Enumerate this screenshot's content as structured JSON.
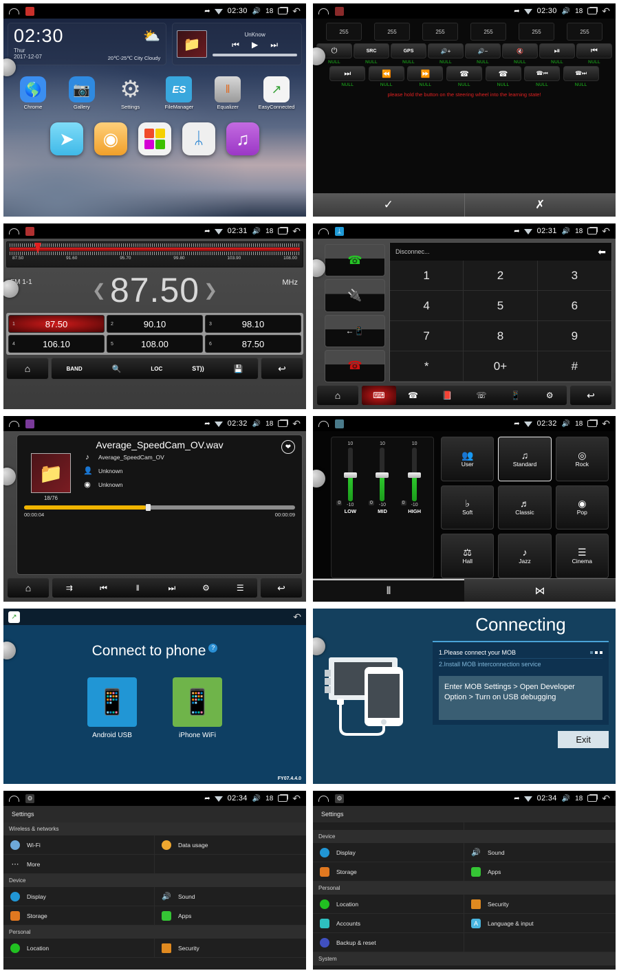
{
  "statusbar": {
    "time_0230": "02:30",
    "time_0231": "02:31",
    "time_0232": "02:32",
    "time_0234": "02:34",
    "volume": "18",
    "key_icon": "key-icon",
    "wifi_icon": "wifi-icon",
    "speaker_icon": "speaker-icon",
    "recents_icon": "recents-icon",
    "back_icon": "back-icon",
    "home_icon": "home-icon"
  },
  "home": {
    "clock": {
      "time": "02:30",
      "day": "Thur",
      "date": "2017-12-07",
      "weather_icon": "sun-cloud-icon",
      "temperature": "20℃-25℃ City Cloudy"
    },
    "media": {
      "title": "UnKnow",
      "prev_icon": "previous-icon",
      "play_icon": "play-icon",
      "next_icon": "next-icon",
      "art_icon": "folder-icon"
    },
    "apps": [
      {
        "label": "Chrome",
        "icon": "chrome-icon",
        "glyph": "●",
        "color": "#3b8ef0"
      },
      {
        "label": "Gallery",
        "icon": "gallery-icon",
        "glyph": "☀",
        "color": "#2f8ae0"
      },
      {
        "label": "Settings",
        "icon": "settings-gear-icon",
        "glyph": "⚙",
        "color": "transparent"
      },
      {
        "label": "FileManager",
        "icon": "file-manager-icon",
        "glyph": "ES",
        "color": "#39a7dd"
      },
      {
        "label": "Equalizer",
        "icon": "equalizer-icon",
        "glyph": "‖",
        "color": "#9c9c9c"
      },
      {
        "label": "EasyConnected",
        "icon": "easy-connected-icon",
        "glyph": "↗",
        "color": "#ffffff"
      }
    ],
    "dock": [
      {
        "icon": "navigation-compass-icon",
        "glyph": "➤",
        "color": "#58cdf5"
      },
      {
        "icon": "radio-disc-icon",
        "glyph": "◉",
        "color": "#f7b34d"
      },
      {
        "icon": "apps-grid-icon",
        "glyph": "",
        "color": "#f2f2f2"
      },
      {
        "icon": "bluetooth-icon",
        "glyph": "ᛦ",
        "color": "#eeeeee"
      },
      {
        "icon": "music-note-icon",
        "glyph": "♫",
        "color": "#b052d8"
      }
    ]
  },
  "steering": {
    "app_icon": "steering-wheel-icon",
    "values": [
      "255",
      "255",
      "255",
      "255",
      "255",
      "255"
    ],
    "row1": [
      {
        "icon": "power-icon",
        "glyph": "⏻",
        "label": "NULL"
      },
      {
        "icon": "src-icon",
        "glyph": "SRC",
        "label": "NULL"
      },
      {
        "icon": "gps-icon",
        "glyph": "GPS",
        "label": "NULL"
      },
      {
        "icon": "volume-up-icon",
        "glyph": "🔊+",
        "label": "NULL"
      },
      {
        "icon": "volume-down-icon",
        "glyph": "🔊−",
        "label": "NULL"
      },
      {
        "icon": "mute-icon",
        "glyph": "🔇",
        "label": "NULL"
      },
      {
        "icon": "play-pause-icon",
        "glyph": "⏯",
        "label": "NULL"
      },
      {
        "icon": "previous-track-icon",
        "glyph": "⏮",
        "label": "NULL"
      }
    ],
    "row2": [
      {
        "icon": "next-track-icon",
        "glyph": "⏭",
        "label": "NULL"
      },
      {
        "icon": "rewind-icon",
        "glyph": "⏪",
        "label": "NULL"
      },
      {
        "icon": "fast-forward-icon",
        "glyph": "⏩",
        "label": "NULL"
      },
      {
        "icon": "call-answer-icon",
        "glyph": "✆",
        "label": "NULL"
      },
      {
        "icon": "call-reject-icon",
        "glyph": "✆",
        "label": "NULL"
      },
      {
        "icon": "call-prev-icon",
        "glyph": "✆",
        "label": "NULL"
      },
      {
        "icon": "call-next-icon",
        "glyph": "✆",
        "label": "NULL"
      }
    ],
    "hint": "please hold the button on the steering wheel into the learning state!",
    "hint_color": "#e02020",
    "confirm_icon": "check-icon",
    "cancel_icon": "close-icon"
  },
  "radio": {
    "app_icon": "radio-icon",
    "scale_labels": [
      "87.50",
      "91.60",
      "95.70",
      "99.80",
      "103.90",
      "108.00"
    ],
    "band": "FM 1-1",
    "frequency": "87.50",
    "unit": "MHz",
    "prev_icon": "chevron-left-icon",
    "next_icon": "chevron-right-icon",
    "presets": [
      {
        "num": "1",
        "freq": "87.50",
        "active": true
      },
      {
        "num": "2",
        "freq": "90.10",
        "active": false
      },
      {
        "num": "3",
        "freq": "98.10",
        "active": false
      },
      {
        "num": "4",
        "freq": "106.10",
        "active": false
      },
      {
        "num": "5",
        "freq": "108.00",
        "active": false
      },
      {
        "num": "6",
        "freq": "87.50",
        "active": false
      }
    ],
    "toolbar": [
      {
        "icon": "home-button-icon",
        "glyph": "⌂"
      },
      {
        "icon": "band-icon",
        "glyph": "BAND"
      },
      {
        "icon": "scan-search-icon",
        "glyph": "🔍"
      },
      {
        "icon": "loc-icon",
        "glyph": "LOC"
      },
      {
        "icon": "stereo-icon",
        "glyph": "ST))"
      },
      {
        "icon": "save-icon",
        "glyph": "💾"
      },
      {
        "icon": "back-button-icon",
        "glyph": "↩"
      }
    ]
  },
  "bluetooth": {
    "app_icon": "bluetooth-icon",
    "status": "Disconnec...",
    "backspace_icon": "backspace-arrow-icon",
    "side_buttons": [
      {
        "icon": "call-answer-icon",
        "glyph": "✆",
        "color": "#25c425"
      },
      {
        "icon": "pair-plug-icon",
        "glyph": "🔌",
        "color": "#ffffff"
      },
      {
        "icon": "transfer-to-phone-icon",
        "glyph": "←▯",
        "color": "#ffffff"
      },
      {
        "icon": "call-end-icon",
        "glyph": "✆",
        "color": "#cc1111"
      }
    ],
    "keys": [
      "1",
      "2",
      "3",
      "4",
      "5",
      "6",
      "7",
      "8",
      "9",
      "*",
      "0+",
      "#"
    ],
    "toolbar": [
      {
        "icon": "home-button-icon",
        "glyph": "⌂",
        "active": false
      },
      {
        "icon": "dialpad-icon",
        "glyph": "⌸",
        "active": true
      },
      {
        "icon": "call-log-icon",
        "glyph": "✆",
        "active": false
      },
      {
        "icon": "contacts-book-icon",
        "glyph": "📕",
        "active": false
      },
      {
        "icon": "missed-call-icon",
        "glyph": "✆",
        "active": false
      },
      {
        "icon": "bt-music-icon",
        "glyph": "📱",
        "active": false
      },
      {
        "icon": "settings-gear-icon",
        "glyph": "⚙",
        "active": false
      },
      {
        "icon": "back-button-icon",
        "glyph": "↩",
        "active": false
      }
    ]
  },
  "music": {
    "app_icon": "music-player-icon",
    "file_name": "Average_SpeedCam_OV.wav",
    "favorite_icon": "heart-icon",
    "album_art_icon": "folder-icon",
    "track_index": "18/76",
    "meta": [
      {
        "icon": "note-icon",
        "glyph": "♪",
        "value": "Average_SpeedCam_OV"
      },
      {
        "icon": "artist-icon",
        "glyph": "👤",
        "value": "Unknown"
      },
      {
        "icon": "album-disc-icon",
        "glyph": "◉",
        "value": "Unknown"
      }
    ],
    "time_elapsed": "00:00:04",
    "time_total": "00:00:09",
    "progress_percent": 45,
    "progress_color": "#f0b400",
    "toolbar": [
      {
        "icon": "home-button-icon",
        "glyph": "⌂"
      },
      {
        "icon": "shuffle-icon",
        "glyph": "⇉"
      },
      {
        "icon": "previous-track-icon",
        "glyph": "⏮"
      },
      {
        "icon": "pause-icon",
        "glyph": "‖"
      },
      {
        "icon": "next-track-icon",
        "glyph": "⏭"
      },
      {
        "icon": "settings-gear-icon",
        "glyph": "⚙"
      },
      {
        "icon": "playlist-icon",
        "glyph": "☰"
      },
      {
        "icon": "back-button-icon",
        "glyph": "↩"
      }
    ]
  },
  "equalizer": {
    "app_icon": "equalizer-icon",
    "sliders": [
      {
        "name": "LOW",
        "value": "0",
        "max": "10",
        "min": "-10"
      },
      {
        "name": "MID",
        "value": "0",
        "max": "10",
        "min": "-10"
      },
      {
        "name": "HIGH",
        "value": "0",
        "max": "10",
        "min": "-10"
      }
    ],
    "presets": [
      {
        "label": "User",
        "icon": "user-icon",
        "glyph": "👥",
        "selected": false
      },
      {
        "label": "Standard",
        "icon": "standard-note-icon",
        "glyph": "♫",
        "selected": true
      },
      {
        "label": "Rock",
        "icon": "rock-drum-icon",
        "glyph": "◎",
        "selected": false
      },
      {
        "label": "Soft",
        "icon": "soft-piano-icon",
        "glyph": "⬜",
        "selected": false
      },
      {
        "label": "Classic",
        "icon": "classic-gramophone-icon",
        "glyph": "♬",
        "selected": false
      },
      {
        "label": "Pop",
        "icon": "pop-disc-icon",
        "glyph": "◉",
        "selected": false
      },
      {
        "label": "Hall",
        "icon": "hall-icon",
        "glyph": "⚘",
        "selected": false
      },
      {
        "label": "Jazz",
        "icon": "jazz-sax-icon",
        "glyph": "♮",
        "selected": false
      },
      {
        "label": "Cinema",
        "icon": "cinema-icon",
        "glyph": "☰",
        "selected": false
      }
    ],
    "tabs": [
      {
        "icon": "eq-sliders-tab-icon",
        "glyph": "⦀",
        "active": true
      },
      {
        "icon": "balance-fader-tab-icon",
        "glyph": "⋈",
        "active": false
      }
    ]
  },
  "connect_phone": {
    "app_icon": "easy-connected-icon",
    "back_icon": "back-icon",
    "title": "Connect to phone",
    "help_icon": "help-icon",
    "options": [
      {
        "label": "Android USB",
        "icon": "android-usb-icon",
        "color": "#2196d5"
      },
      {
        "label": "iPhone WiFi",
        "icon": "iphone-wifi-icon",
        "color": "#6fb44a"
      }
    ],
    "version": "FY07.4.4.0"
  },
  "connecting": {
    "title": "Connecting",
    "illustration_icon": "head-unit-phone-cable-icon",
    "steps": [
      {
        "text": "1.Please connect your MOB",
        "active": true
      },
      {
        "text": "2.Install MOB interconnection service",
        "active": false
      }
    ],
    "note": "Enter MOB Settings > Open Developer Option > Turn on USB debugging",
    "exit_label": "Exit"
  },
  "settings_left": {
    "app_icon": "settings-gear-icon",
    "title": "Settings",
    "groups": [
      {
        "name": "Wireless & networks",
        "items": [
          {
            "label": "Wi-Fi",
            "icon": "wifi-icon",
            "color": "#6ea8d8"
          },
          {
            "label": "Data usage",
            "icon": "data-usage-icon",
            "color": "#f0a830"
          },
          {
            "label": "More",
            "icon": "more-dots-icon",
            "color": "#2a2a2a"
          },
          {
            "label": "",
            "icon": "",
            "color": "transparent"
          }
        ]
      },
      {
        "name": "Device",
        "items": [
          {
            "label": "Display",
            "icon": "display-icon",
            "color": "#2196d5"
          },
          {
            "label": "Sound",
            "icon": "sound-icon",
            "color": "#c040d0"
          },
          {
            "label": "Storage",
            "icon": "storage-icon",
            "color": "#e07820"
          },
          {
            "label": "Apps",
            "icon": "apps-icon",
            "color": "#35c535"
          }
        ]
      },
      {
        "name": "Personal",
        "items": [
          {
            "label": "Location",
            "icon": "location-icon",
            "color": "#21c021"
          },
          {
            "label": "Security",
            "icon": "security-lock-icon",
            "color": "#e08a20"
          }
        ]
      }
    ]
  },
  "settings_right": {
    "app_icon": "settings-gear-icon",
    "title": "Settings",
    "groups": [
      {
        "name": "Device",
        "items": [
          {
            "label": "Display",
            "icon": "display-icon",
            "color": "#2196d5"
          },
          {
            "label": "Sound",
            "icon": "sound-icon",
            "color": "#c040d0"
          },
          {
            "label": "Storage",
            "icon": "storage-icon",
            "color": "#e07820"
          },
          {
            "label": "Apps",
            "icon": "apps-icon",
            "color": "#35c535"
          }
        ]
      },
      {
        "name": "Personal",
        "items": [
          {
            "label": "Location",
            "icon": "location-icon",
            "color": "#21c021"
          },
          {
            "label": "Security",
            "icon": "security-lock-icon",
            "color": "#e08a20"
          },
          {
            "label": "Accounts",
            "icon": "accounts-icon",
            "color": "#2ec0c0"
          },
          {
            "label": "Language & input",
            "icon": "language-input-icon",
            "color": "#4ab6e0"
          },
          {
            "label": "Backup & reset",
            "icon": "backup-reset-icon",
            "color": "#4050c0"
          },
          {
            "label": "",
            "icon": "",
            "color": "transparent"
          }
        ]
      },
      {
        "name": "System",
        "items": []
      }
    ]
  }
}
